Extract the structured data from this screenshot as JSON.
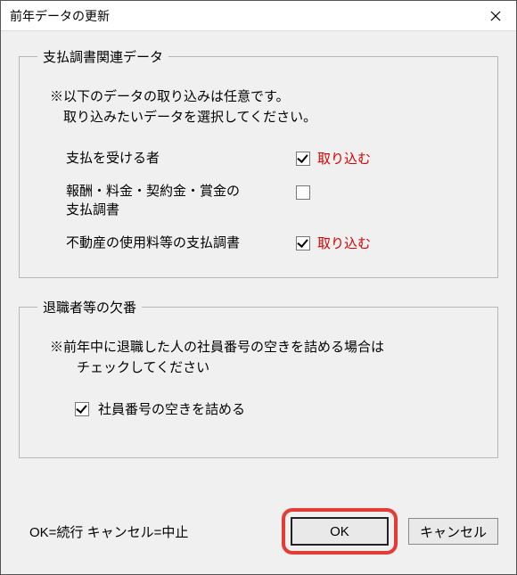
{
  "title": "前年データの更新",
  "group1": {
    "legend": "支払調書関連データ",
    "note_line1": "※以下のデータの取り込みは任意です。",
    "note_line2": "　取り込みたいデータを選択してください。",
    "options": {
      "payee": {
        "label": "支払を受ける者",
        "checked": true,
        "import_label": "取り込む"
      },
      "reward": {
        "label": "報酬・料金・契約金・賞金の\n支払調書",
        "checked": false,
        "import_label": ""
      },
      "realestate": {
        "label": "不動産の使用料等の支払調書",
        "checked": true,
        "import_label": "取り込む"
      }
    }
  },
  "group2": {
    "legend": "退職者等の欠番",
    "note_line1": "※前年中に退職した人の社員番号の空きを詰める場合は",
    "note_line2": "　　チェックしてください",
    "option": {
      "label": "社員番号の空きを詰める",
      "checked": true
    }
  },
  "footer": {
    "hint": "OK=続行 キャンセル=中止",
    "ok": "OK",
    "cancel": "キャンセル"
  }
}
